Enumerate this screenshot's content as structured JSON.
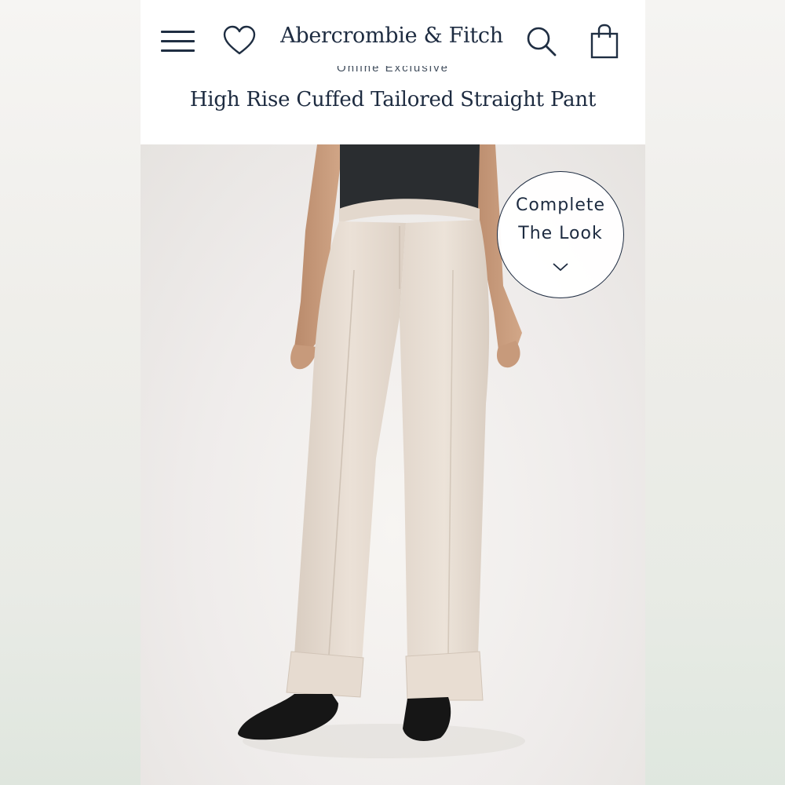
{
  "app": {
    "brand": "Abercrombie & Fitch",
    "colors": {
      "ink": "#1d2b40",
      "background": "#ffffff",
      "pant": "#e7dcd1",
      "top": "#2a2d30",
      "shoe": "#151515"
    }
  },
  "header": {
    "icons": [
      "menu-icon",
      "heart-icon",
      "search-icon",
      "bag-icon"
    ],
    "logo": "Abercrombie & Fitch"
  },
  "product": {
    "badge": "Online Exclusive",
    "title": "High Rise Cuffed Tailored Straight Pant"
  },
  "complete_look": {
    "line1": "Complete",
    "line2": "The Look",
    "icon": "chevron-down-icon"
  }
}
